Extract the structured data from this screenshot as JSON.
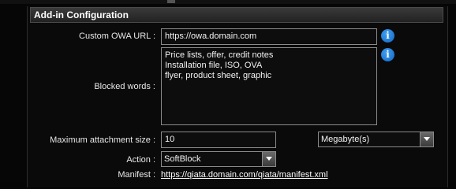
{
  "section": {
    "title": "Add-in Configuration"
  },
  "owa_url": {
    "label": "Custom OWA URL :",
    "value": "https://owa.domain.com",
    "info_icon": "info-icon"
  },
  "blocked_words": {
    "label": "Blocked words :",
    "lines": [
      "Price lists, offer, credit notes",
      "Installation file, ISO, OVA",
      "flyer, product sheet, graphic"
    ],
    "info_icon": "info-icon"
  },
  "max_attachment": {
    "label": "Maximum attachment size :",
    "value": "10",
    "unit": "Megabyte(s)"
  },
  "action": {
    "label": "Action :",
    "value": "SoftBlock"
  },
  "manifest": {
    "label": "Manifest :",
    "link": "https://qiata.domain.com/qiata/manifest.xml"
  },
  "colors": {
    "background": "#060606",
    "info_icon": "#1f7fdc",
    "border": "#8a8a8a"
  }
}
